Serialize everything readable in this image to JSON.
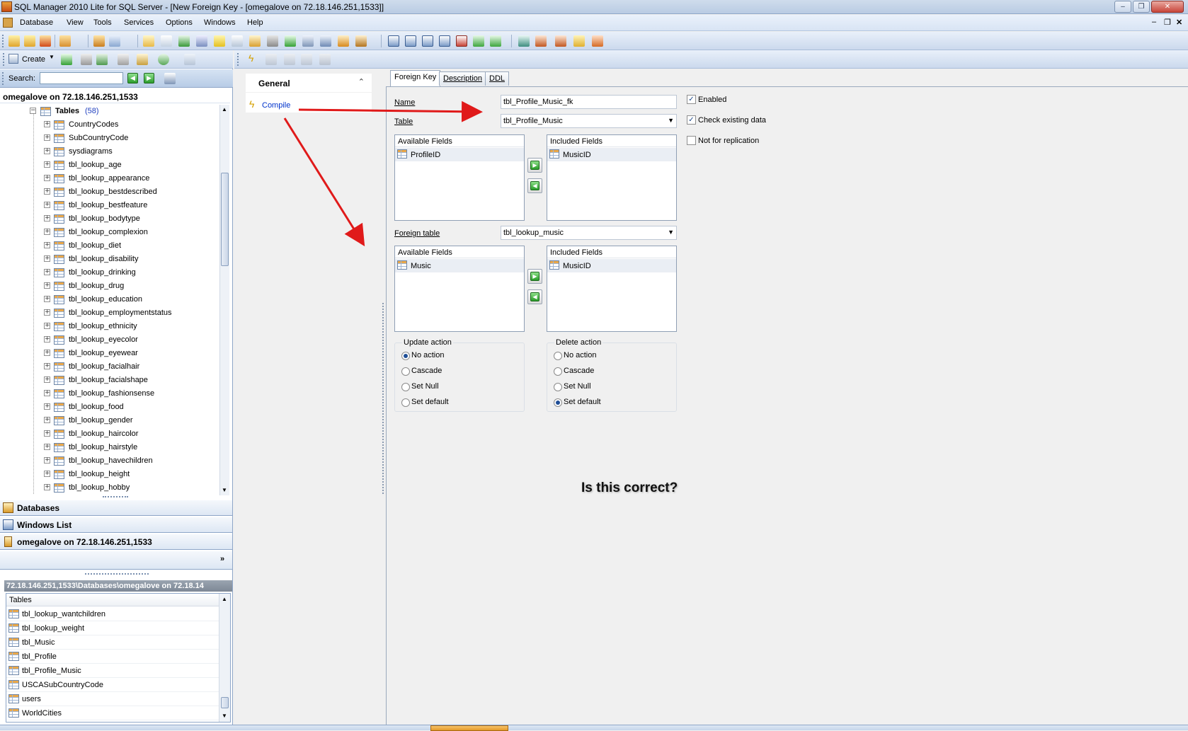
{
  "window": {
    "title": "SQL Manager 2010 Lite for SQL Server - [New Foreign Key - [omegalove on 72.18.146.251,1533]]",
    "min": "‒",
    "restore": "❐",
    "close": "✕"
  },
  "mdi_controls": {
    "min": "‒",
    "restore": "❐",
    "close": "✕"
  },
  "menu": [
    "Database",
    "View",
    "Tools",
    "Services",
    "Options",
    "Windows",
    "Help"
  ],
  "left": {
    "create_label": "Create",
    "search_label": "Search:",
    "search_value": "",
    "connection": "omegalove on 72.18.146.251,1533",
    "tables_node": "Tables",
    "tables_count": "(58)",
    "tables": [
      "CountryCodes",
      "SubCountryCode",
      "sysdiagrams",
      "tbl_lookup_age",
      "tbl_lookup_appearance",
      "tbl_lookup_bestdescribed",
      "tbl_lookup_bestfeature",
      "tbl_lookup_bodytype",
      "tbl_lookup_complexion",
      "tbl_lookup_diet",
      "tbl_lookup_disability",
      "tbl_lookup_drinking",
      "tbl_lookup_drug",
      "tbl_lookup_education",
      "tbl_lookup_employmentstatus",
      "tbl_lookup_ethnicity",
      "tbl_lookup_eyecolor",
      "tbl_lookup_eyewear",
      "tbl_lookup_facialhair",
      "tbl_lookup_facialshape",
      "tbl_lookup_fashionsense",
      "tbl_lookup_food",
      "tbl_lookup_gender",
      "tbl_lookup_haircolor",
      "tbl_lookup_hairstyle",
      "tbl_lookup_havechildren",
      "tbl_lookup_height",
      "tbl_lookup_hobby"
    ],
    "nav": {
      "databases": "Databases",
      "windows_list": "Windows List",
      "connection": "omegalove on 72.18.146.251,1533"
    },
    "path": "72.18.146.251,1533\\Databases\\omegalove on 72.18.14",
    "objects_header": "Tables",
    "objects": [
      "tbl_lookup_wantchildren",
      "tbl_lookup_weight",
      "tbl_Music",
      "tbl_Profile",
      "tbl_Profile_Music",
      "USCASubCountryCode",
      "users",
      "WorldCities"
    ]
  },
  "nav_pane": {
    "general": "General",
    "compile": "Compile"
  },
  "editor": {
    "tabs": [
      "Foreign Key",
      "Description",
      "DDL"
    ],
    "active_tab": "Foreign Key",
    "name_label": "Name",
    "name_value": "tbl_Profile_Music_fk",
    "table_label": "Table",
    "table_value": "tbl_Profile_Music",
    "enabled_label": "Enabled",
    "enabled": true,
    "check_existing_label": "Check existing data",
    "check_existing": true,
    "not_for_replication_label": "Not for replication",
    "not_for_replication": false,
    "available_fields_label": "Available Fields",
    "included_fields_label": "Included Fields",
    "available_fields": [
      "ProfileID"
    ],
    "included_fields": [
      "MusicID"
    ],
    "foreign_table_label": "Foreign table",
    "foreign_table_value": "tbl_lookup_music",
    "foreign_available_fields": [
      "Music"
    ],
    "foreign_included_fields": [
      "MusicID"
    ],
    "update_action": {
      "label": "Update action",
      "options": [
        "No action",
        "Cascade",
        "Set Null",
        "Set default"
      ],
      "selected": "No action"
    },
    "delete_action": {
      "label": "Delete action",
      "options": [
        "No action",
        "Cascade",
        "Set Null",
        "Set default"
      ],
      "selected": "Set default"
    }
  },
  "annotation": {
    "question": "Is this correct?",
    "arrow_color": "#e01a1a"
  }
}
